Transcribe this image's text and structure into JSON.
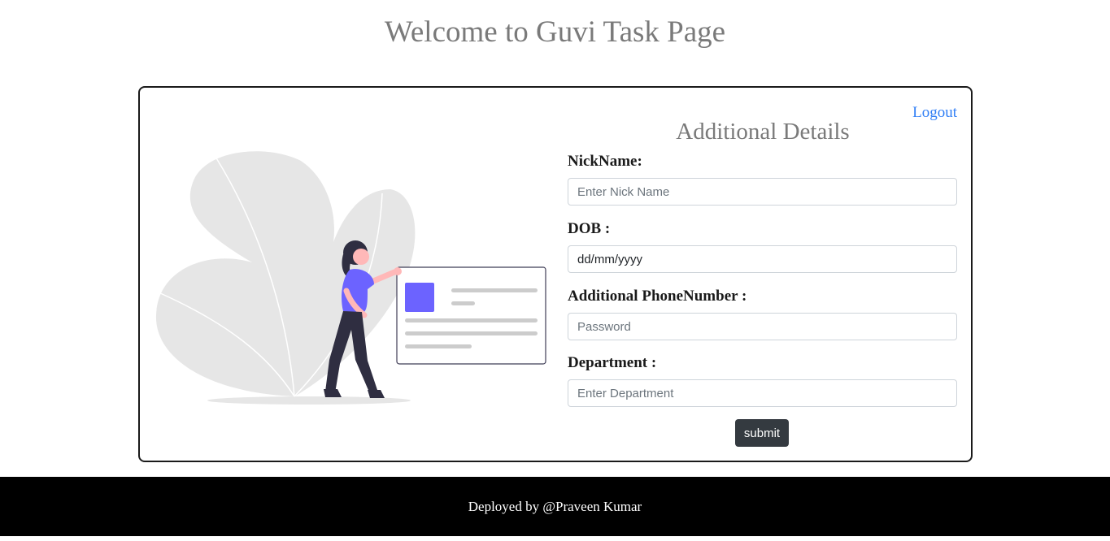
{
  "page": {
    "title": "Welcome to Guvi Task Page"
  },
  "header": {
    "logout_label": "Logout"
  },
  "form": {
    "title": "Additional Details",
    "fields": [
      {
        "label": "NickName:",
        "placeholder": "Enter Nick Name",
        "value": ""
      },
      {
        "label": "DOB :",
        "placeholder": "dd/mm/yyyy",
        "value": "dd/mm/yyyy"
      },
      {
        "label": "Additional PhoneNumber :",
        "placeholder": "Password",
        "value": ""
      },
      {
        "label": "Department :",
        "placeholder": "Enter Department",
        "value": ""
      }
    ],
    "submit_label": "submit"
  },
  "footer": {
    "text": "Deployed by @Praveen Kumar"
  },
  "colors": {
    "link": "#2f7ef5",
    "button_bg": "#343a40",
    "footer_bg": "#000000",
    "illustration_accent": "#6c63ff",
    "leaf_gray": "#e6e6e6"
  }
}
